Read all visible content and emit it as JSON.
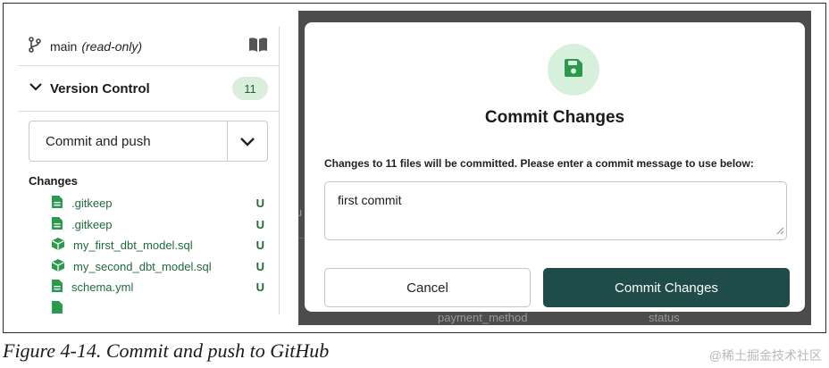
{
  "sidebar": {
    "branch": {
      "name": "main",
      "mode": "(read-only)",
      "branch_icon": "git-branch-icon",
      "docs_icon": "book-icon"
    },
    "version_control": {
      "label": "Version Control",
      "count": "11",
      "chevron_icon": "chevron-down-icon"
    },
    "action_select": {
      "value": "Commit and push",
      "chevron_icon": "chevron-down-icon"
    },
    "changes_heading": "Changes",
    "files": [
      {
        "name": ".gitkeep",
        "status": "U",
        "icon": "file-icon"
      },
      {
        "name": ".gitkeep",
        "status": "U",
        "icon": "file-icon"
      },
      {
        "name": "my_first_dbt_model.sql",
        "status": "U",
        "icon": "cube-icon"
      },
      {
        "name": "my_second_dbt_model.sql",
        "status": "U",
        "icon": "cube-icon"
      },
      {
        "name": "schema.yml",
        "status": "U",
        "icon": "file-icon"
      }
    ]
  },
  "background": {
    "fragment_bottom_left": "payment_method",
    "fragment_bottom_right": "status",
    "fragment_left": "lu"
  },
  "modal": {
    "icon": "save-icon",
    "title": "Commit Changes",
    "description": "Changes to 11 files will be committed. Please enter a commit message to use below:",
    "message": "first commit",
    "cancel_label": "Cancel",
    "commit_label": "Commit Changes"
  },
  "caption": "Figure 4-14. Commit and push to GitHub",
  "watermark": "@稀土掘金技术社区",
  "colors": {
    "accent_dark": "#1f4b48",
    "icon_green": "#2c9a4e",
    "badge_bg": "#d9efdc",
    "overlay": "#4c4c4c"
  }
}
